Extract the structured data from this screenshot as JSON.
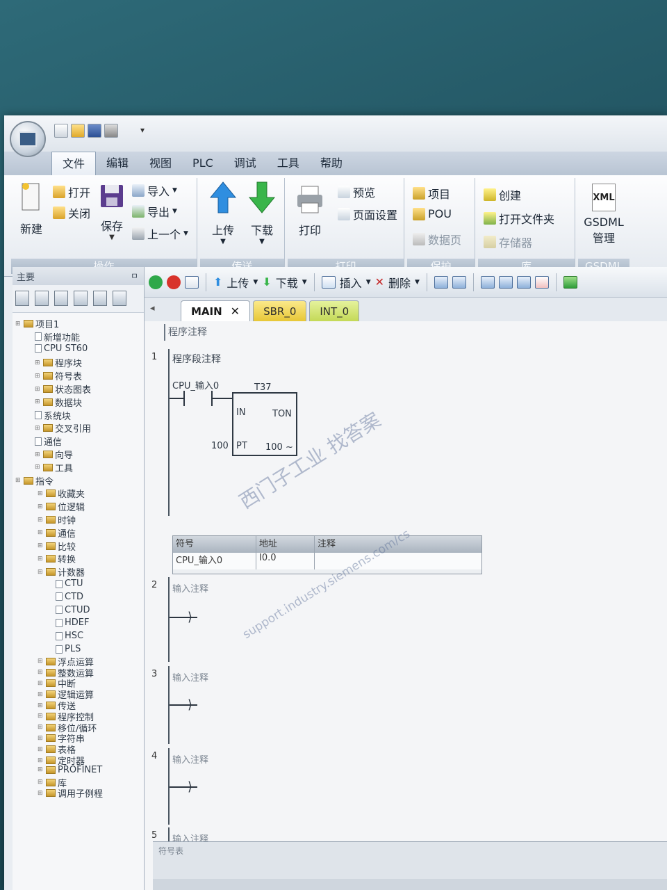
{
  "menu": [
    "文件",
    "编辑",
    "视图",
    "PLC",
    "调试",
    "工具",
    "帮助"
  ],
  "ribbon": {
    "ops": {
      "new": "新建",
      "open": "打开",
      "close": "关闭",
      "save": "保存",
      "import": "导入",
      "export": "导出",
      "prev": "上一个",
      "caption": "操作"
    },
    "transfer": {
      "upload": "上传",
      "download": "下载",
      "caption": "传送"
    },
    "print": {
      "print": "打印",
      "preview": "预览",
      "page_setup": "页面设置",
      "caption": "打印"
    },
    "protect": {
      "project": "项目",
      "pou": "POU",
      "data_page": "数据页",
      "caption": "保护"
    },
    "library": {
      "create": "创建",
      "open_folder": "打开文件夹",
      "memory": "存储器",
      "caption": "库"
    },
    "gsdml": {
      "xml": "XML",
      "l1": "GSDML",
      "l2": "管理",
      "caption": "GSDML"
    }
  },
  "left_panel": {
    "header": "主要",
    "pin": "ㅁ",
    "tree": [
      {
        "label": "项目1",
        "type": "root"
      },
      {
        "label": "新增功能",
        "type": "item"
      },
      {
        "label": "CPU ST60",
        "type": "item"
      },
      {
        "label": "程序块",
        "type": "folder"
      },
      {
        "label": "符号表",
        "type": "folder"
      },
      {
        "label": "状态图表",
        "type": "folder"
      },
      {
        "label": "数据块",
        "type": "folder"
      },
      {
        "label": "系统块",
        "type": "item"
      },
      {
        "label": "交叉引用",
        "type": "folder"
      },
      {
        "label": "通信",
        "type": "item"
      },
      {
        "label": "向导",
        "type": "folder"
      },
      {
        "label": "工具",
        "type": "folder"
      },
      {
        "label": "指令",
        "type": "root"
      },
      {
        "label": "收藏夹",
        "type": "folder"
      },
      {
        "label": "位逻辑",
        "type": "folder"
      },
      {
        "label": "时钟",
        "type": "folder"
      },
      {
        "label": "通信",
        "type": "folder"
      },
      {
        "label": "比较",
        "type": "folder"
      },
      {
        "label": "转换",
        "type": "folder"
      },
      {
        "label": "计数器",
        "type": "folder"
      },
      {
        "label": "CTU",
        "type": "leaf"
      },
      {
        "label": "CTD",
        "type": "leaf"
      },
      {
        "label": "CTUD",
        "type": "leaf"
      },
      {
        "label": "HDEF",
        "type": "leaf"
      },
      {
        "label": "HSC",
        "type": "leaf"
      },
      {
        "label": "PLS",
        "type": "leaf"
      },
      {
        "label": "浮点运算",
        "type": "folder"
      },
      {
        "label": "整数运算",
        "type": "folder"
      },
      {
        "label": "中断",
        "type": "folder"
      },
      {
        "label": "逻辑运算",
        "type": "folder"
      },
      {
        "label": "传送",
        "type": "folder"
      },
      {
        "label": "程序控制",
        "type": "folder"
      },
      {
        "label": "移位/循环",
        "type": "folder"
      },
      {
        "label": "字符串",
        "type": "folder"
      },
      {
        "label": "表格",
        "type": "folder"
      },
      {
        "label": "定时器",
        "type": "folder"
      },
      {
        "label": "PROFINET",
        "type": "folder"
      },
      {
        "label": "库",
        "type": "folder"
      },
      {
        "label": "调用子例程",
        "type": "folder"
      }
    ]
  },
  "editor_toolbar": {
    "upload": "上传",
    "download": "下载",
    "insert": "插入",
    "delete": "删除"
  },
  "tabs": [
    {
      "label": "MAIN",
      "close": "✕"
    },
    {
      "label": "SBR_0"
    },
    {
      "label": "INT_0"
    }
  ],
  "editor": {
    "program_comment": "程序注释",
    "network1": {
      "num": "1",
      "comment": "程序段注释",
      "contact_label": "CPU_输入0",
      "timer_name": "T37",
      "in_label": "IN",
      "ton_label": "TON",
      "pt_label": "PT",
      "pt_value": "100",
      "time_unit": "100 ~",
      "symbol_table": {
        "headers": [
          "符号",
          "地址",
          "注释"
        ],
        "row": [
          "CPU_输入0",
          "I0.0",
          ""
        ]
      }
    },
    "networks": [
      {
        "num": "2",
        "comment": "输入注释"
      },
      {
        "num": "3",
        "comment": "输入注释"
      },
      {
        "num": "4",
        "comment": "输入注释"
      },
      {
        "num": "5",
        "comment": "输入注释"
      }
    ]
  },
  "watermark": {
    "line1": "西门子工业 找答案",
    "line2": "support.industry.siemens.com/cs"
  },
  "bottom_panel": {
    "header": "符号表"
  }
}
